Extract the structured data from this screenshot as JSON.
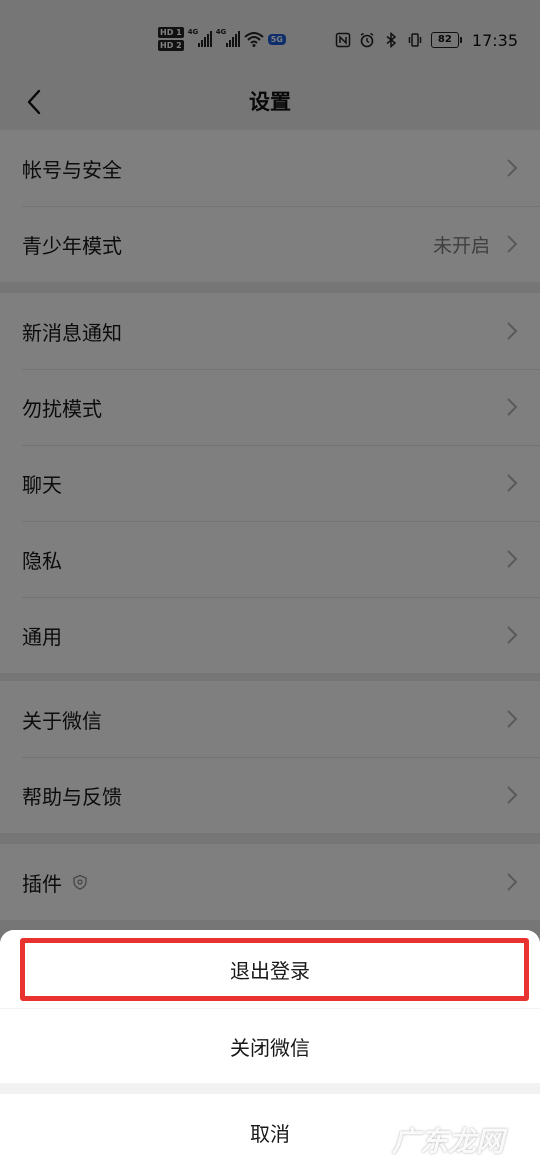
{
  "status_bar": {
    "hd1": "HD 1",
    "hd2": "HD 2",
    "net1": "4G",
    "net2": "4G",
    "network": "5G",
    "battery": "82",
    "time": "17:35"
  },
  "nav": {
    "title": "设置"
  },
  "groups": [
    {
      "items": [
        {
          "label": "帐号与安全",
          "value": ""
        },
        {
          "label": "青少年模式",
          "value": "未开启"
        }
      ]
    },
    {
      "items": [
        {
          "label": "新消息通知",
          "value": ""
        },
        {
          "label": "勿扰模式",
          "value": ""
        },
        {
          "label": "聊天",
          "value": ""
        },
        {
          "label": "隐私",
          "value": ""
        },
        {
          "label": "通用",
          "value": ""
        }
      ]
    },
    {
      "items": [
        {
          "label": "关于微信",
          "value": ""
        },
        {
          "label": "帮助与反馈",
          "value": ""
        }
      ]
    },
    {
      "items": [
        {
          "label": "插件",
          "value": ""
        }
      ]
    }
  ],
  "action_sheet": {
    "logout": "退出登录",
    "close_wechat": "关闭微信",
    "cancel": "取消"
  },
  "watermark": "广东龙网",
  "colors": {
    "highlight_border": "#e8322f",
    "page_background": "#ededed"
  }
}
